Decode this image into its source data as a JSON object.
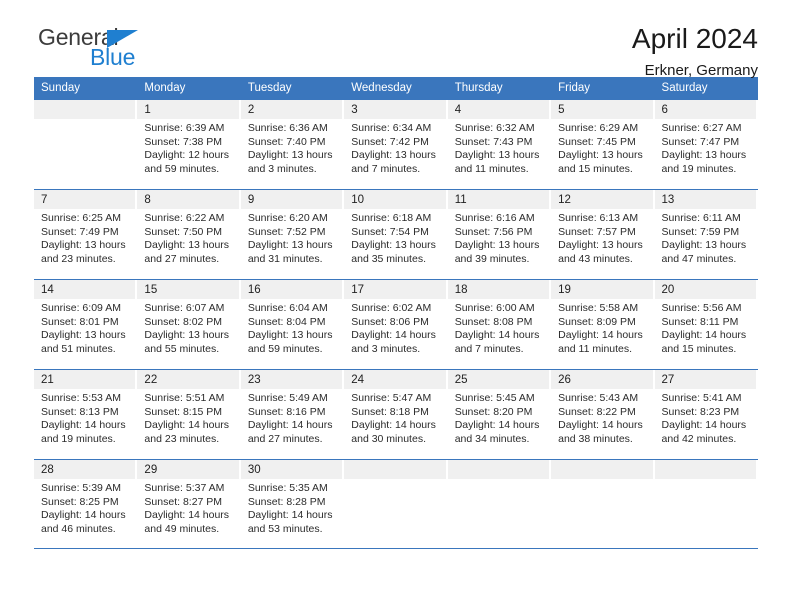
{
  "brand": {
    "name_top": "General",
    "name_bottom": "Blue",
    "triangle_color": "#1f7fd0",
    "top_text_color": "#3c3c3c"
  },
  "header": {
    "title": "April 2024",
    "subtitle": "Erkner, Germany"
  },
  "theme": {
    "header_blue": "#3a76bd",
    "daynum_gray": "#f0f0f0",
    "text": "#222222"
  },
  "weekdays": [
    "Sunday",
    "Monday",
    "Tuesday",
    "Wednesday",
    "Thursday",
    "Friday",
    "Saturday"
  ],
  "weeks": [
    [
      {
        "day": "",
        "sunrise": "",
        "sunset": "",
        "daylight_line1": "",
        "daylight_line2": ""
      },
      {
        "day": "1",
        "sunrise": "Sunrise: 6:39 AM",
        "sunset": "Sunset: 7:38 PM",
        "daylight_line1": "Daylight: 12 hours",
        "daylight_line2": "and 59 minutes."
      },
      {
        "day": "2",
        "sunrise": "Sunrise: 6:36 AM",
        "sunset": "Sunset: 7:40 PM",
        "daylight_line1": "Daylight: 13 hours",
        "daylight_line2": "and 3 minutes."
      },
      {
        "day": "3",
        "sunrise": "Sunrise: 6:34 AM",
        "sunset": "Sunset: 7:42 PM",
        "daylight_line1": "Daylight: 13 hours",
        "daylight_line2": "and 7 minutes."
      },
      {
        "day": "4",
        "sunrise": "Sunrise: 6:32 AM",
        "sunset": "Sunset: 7:43 PM",
        "daylight_line1": "Daylight: 13 hours",
        "daylight_line2": "and 11 minutes."
      },
      {
        "day": "5",
        "sunrise": "Sunrise: 6:29 AM",
        "sunset": "Sunset: 7:45 PM",
        "daylight_line1": "Daylight: 13 hours",
        "daylight_line2": "and 15 minutes."
      },
      {
        "day": "6",
        "sunrise": "Sunrise: 6:27 AM",
        "sunset": "Sunset: 7:47 PM",
        "daylight_line1": "Daylight: 13 hours",
        "daylight_line2": "and 19 minutes."
      }
    ],
    [
      {
        "day": "7",
        "sunrise": "Sunrise: 6:25 AM",
        "sunset": "Sunset: 7:49 PM",
        "daylight_line1": "Daylight: 13 hours",
        "daylight_line2": "and 23 minutes."
      },
      {
        "day": "8",
        "sunrise": "Sunrise: 6:22 AM",
        "sunset": "Sunset: 7:50 PM",
        "daylight_line1": "Daylight: 13 hours",
        "daylight_line2": "and 27 minutes."
      },
      {
        "day": "9",
        "sunrise": "Sunrise: 6:20 AM",
        "sunset": "Sunset: 7:52 PM",
        "daylight_line1": "Daylight: 13 hours",
        "daylight_line2": "and 31 minutes."
      },
      {
        "day": "10",
        "sunrise": "Sunrise: 6:18 AM",
        "sunset": "Sunset: 7:54 PM",
        "daylight_line1": "Daylight: 13 hours",
        "daylight_line2": "and 35 minutes."
      },
      {
        "day": "11",
        "sunrise": "Sunrise: 6:16 AM",
        "sunset": "Sunset: 7:56 PM",
        "daylight_line1": "Daylight: 13 hours",
        "daylight_line2": "and 39 minutes."
      },
      {
        "day": "12",
        "sunrise": "Sunrise: 6:13 AM",
        "sunset": "Sunset: 7:57 PM",
        "daylight_line1": "Daylight: 13 hours",
        "daylight_line2": "and 43 minutes."
      },
      {
        "day": "13",
        "sunrise": "Sunrise: 6:11 AM",
        "sunset": "Sunset: 7:59 PM",
        "daylight_line1": "Daylight: 13 hours",
        "daylight_line2": "and 47 minutes."
      }
    ],
    [
      {
        "day": "14",
        "sunrise": "Sunrise: 6:09 AM",
        "sunset": "Sunset: 8:01 PM",
        "daylight_line1": "Daylight: 13 hours",
        "daylight_line2": "and 51 minutes."
      },
      {
        "day": "15",
        "sunrise": "Sunrise: 6:07 AM",
        "sunset": "Sunset: 8:02 PM",
        "daylight_line1": "Daylight: 13 hours",
        "daylight_line2": "and 55 minutes."
      },
      {
        "day": "16",
        "sunrise": "Sunrise: 6:04 AM",
        "sunset": "Sunset: 8:04 PM",
        "daylight_line1": "Daylight: 13 hours",
        "daylight_line2": "and 59 minutes."
      },
      {
        "day": "17",
        "sunrise": "Sunrise: 6:02 AM",
        "sunset": "Sunset: 8:06 PM",
        "daylight_line1": "Daylight: 14 hours",
        "daylight_line2": "and 3 minutes."
      },
      {
        "day": "18",
        "sunrise": "Sunrise: 6:00 AM",
        "sunset": "Sunset: 8:08 PM",
        "daylight_line1": "Daylight: 14 hours",
        "daylight_line2": "and 7 minutes."
      },
      {
        "day": "19",
        "sunrise": "Sunrise: 5:58 AM",
        "sunset": "Sunset: 8:09 PM",
        "daylight_line1": "Daylight: 14 hours",
        "daylight_line2": "and 11 minutes."
      },
      {
        "day": "20",
        "sunrise": "Sunrise: 5:56 AM",
        "sunset": "Sunset: 8:11 PM",
        "daylight_line1": "Daylight: 14 hours",
        "daylight_line2": "and 15 minutes."
      }
    ],
    [
      {
        "day": "21",
        "sunrise": "Sunrise: 5:53 AM",
        "sunset": "Sunset: 8:13 PM",
        "daylight_line1": "Daylight: 14 hours",
        "daylight_line2": "and 19 minutes."
      },
      {
        "day": "22",
        "sunrise": "Sunrise: 5:51 AM",
        "sunset": "Sunset: 8:15 PM",
        "daylight_line1": "Daylight: 14 hours",
        "daylight_line2": "and 23 minutes."
      },
      {
        "day": "23",
        "sunrise": "Sunrise: 5:49 AM",
        "sunset": "Sunset: 8:16 PM",
        "daylight_line1": "Daylight: 14 hours",
        "daylight_line2": "and 27 minutes."
      },
      {
        "day": "24",
        "sunrise": "Sunrise: 5:47 AM",
        "sunset": "Sunset: 8:18 PM",
        "daylight_line1": "Daylight: 14 hours",
        "daylight_line2": "and 30 minutes."
      },
      {
        "day": "25",
        "sunrise": "Sunrise: 5:45 AM",
        "sunset": "Sunset: 8:20 PM",
        "daylight_line1": "Daylight: 14 hours",
        "daylight_line2": "and 34 minutes."
      },
      {
        "day": "26",
        "sunrise": "Sunrise: 5:43 AM",
        "sunset": "Sunset: 8:22 PM",
        "daylight_line1": "Daylight: 14 hours",
        "daylight_line2": "and 38 minutes."
      },
      {
        "day": "27",
        "sunrise": "Sunrise: 5:41 AM",
        "sunset": "Sunset: 8:23 PM",
        "daylight_line1": "Daylight: 14 hours",
        "daylight_line2": "and 42 minutes."
      }
    ],
    [
      {
        "day": "28",
        "sunrise": "Sunrise: 5:39 AM",
        "sunset": "Sunset: 8:25 PM",
        "daylight_line1": "Daylight: 14 hours",
        "daylight_line2": "and 46 minutes."
      },
      {
        "day": "29",
        "sunrise": "Sunrise: 5:37 AM",
        "sunset": "Sunset: 8:27 PM",
        "daylight_line1": "Daylight: 14 hours",
        "daylight_line2": "and 49 minutes."
      },
      {
        "day": "30",
        "sunrise": "Sunrise: 5:35 AM",
        "sunset": "Sunset: 8:28 PM",
        "daylight_line1": "Daylight: 14 hours",
        "daylight_line2": "and 53 minutes."
      },
      {
        "day": "",
        "sunrise": "",
        "sunset": "",
        "daylight_line1": "",
        "daylight_line2": ""
      },
      {
        "day": "",
        "sunrise": "",
        "sunset": "",
        "daylight_line1": "",
        "daylight_line2": ""
      },
      {
        "day": "",
        "sunrise": "",
        "sunset": "",
        "daylight_line1": "",
        "daylight_line2": ""
      },
      {
        "day": "",
        "sunrise": "",
        "sunset": "",
        "daylight_line1": "",
        "daylight_line2": ""
      }
    ]
  ]
}
